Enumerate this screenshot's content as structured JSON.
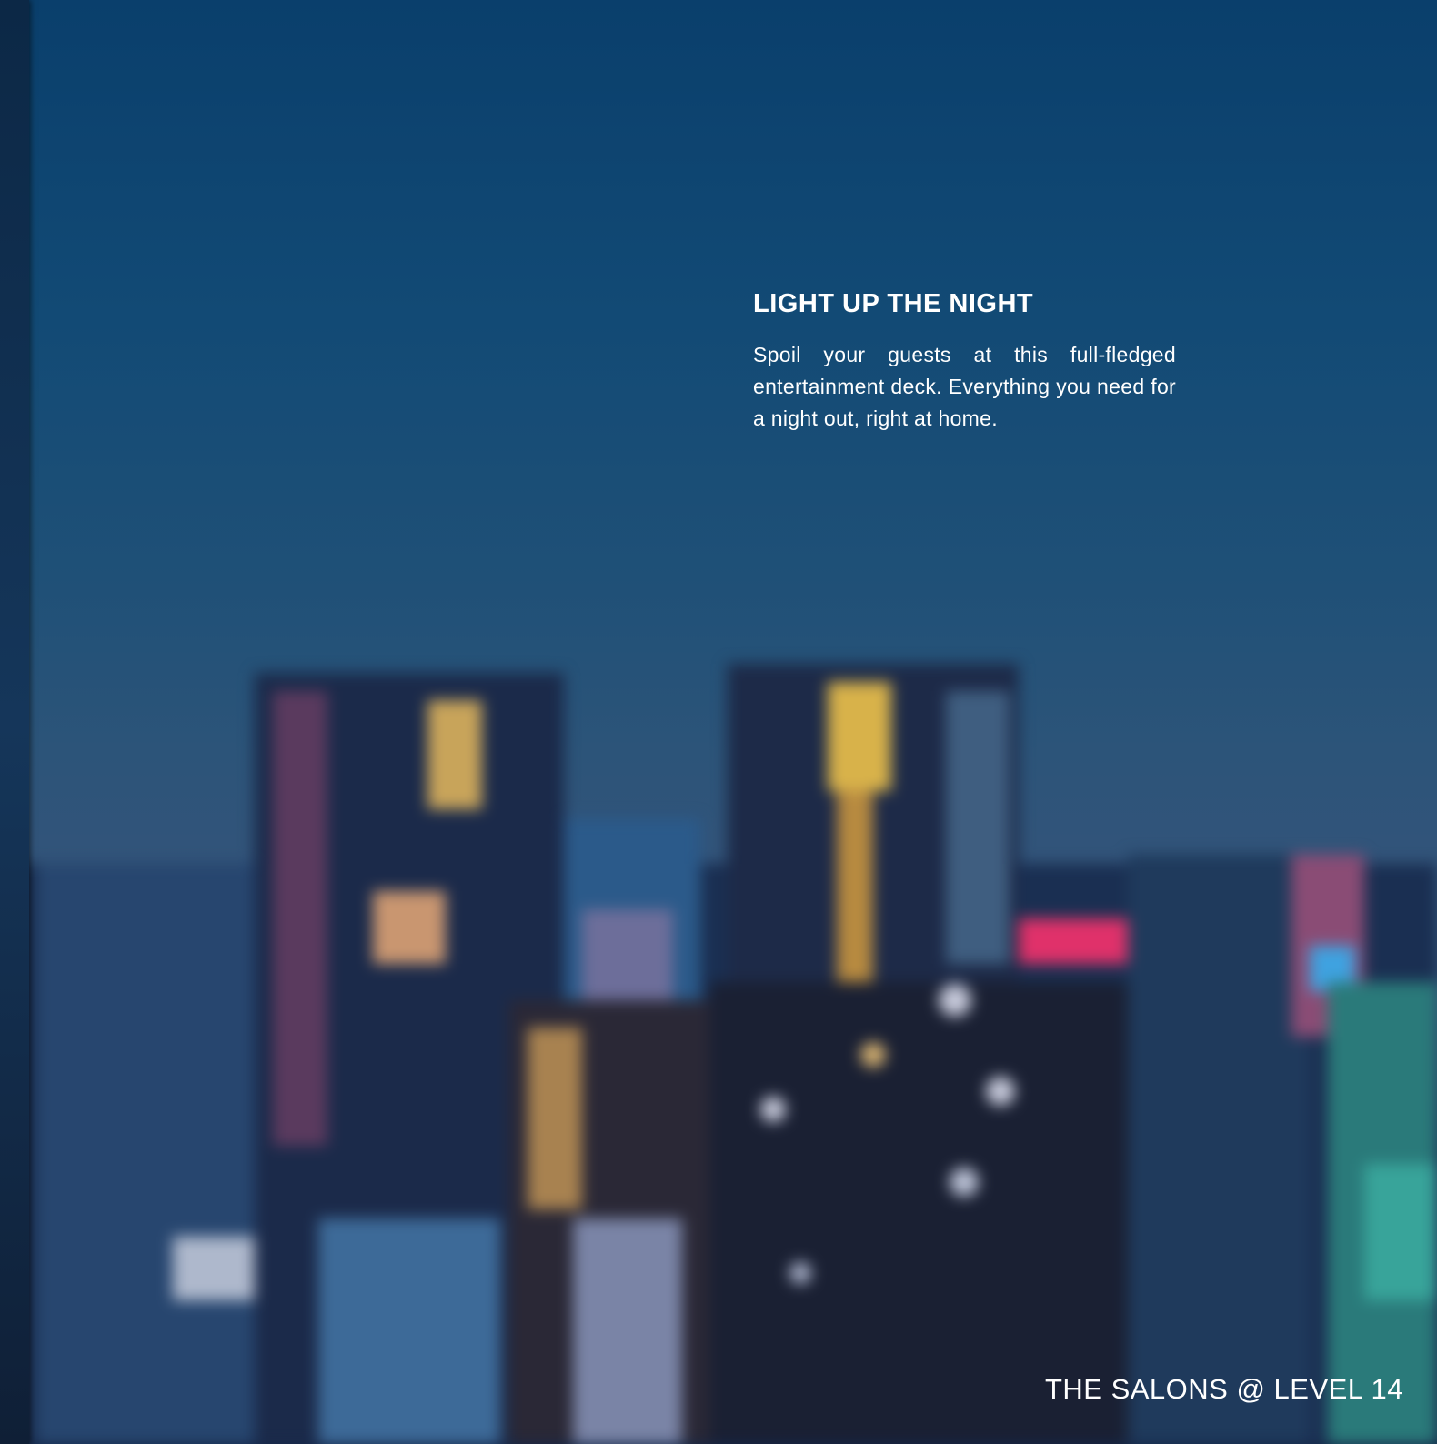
{
  "heading": "LIGHT UP THE NIGHT",
  "paragraph": "Spoil your guests at this full-fledged entertainment deck. Everything you need for a night out, right at home.",
  "footer": "THE SALONS @ LEVEL 14",
  "colors": {
    "sky_top": "#0a3f6c",
    "sky_mid": "#2c5479",
    "buildings": "#16284a",
    "text": "#ffffff"
  },
  "image": {
    "subject": "blurred-city-skyline-at-dusk"
  }
}
